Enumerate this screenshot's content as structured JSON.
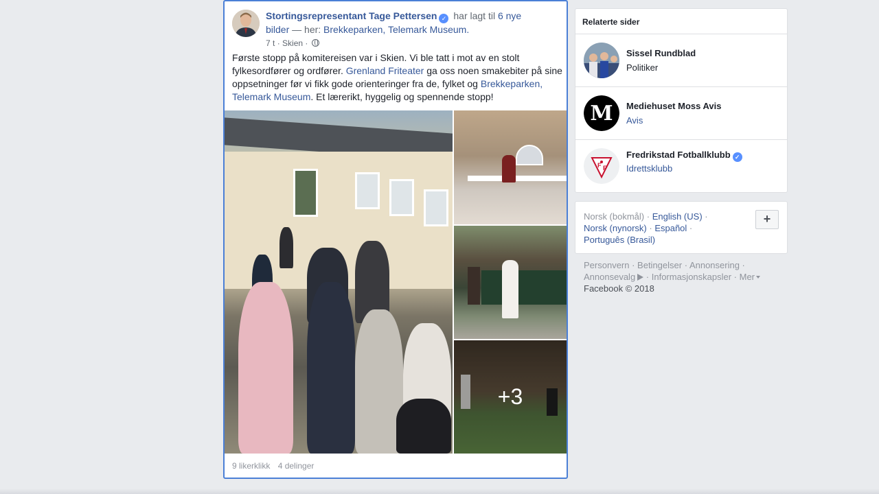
{
  "post": {
    "author": "Stortingsrepresentant Tage Pettersen",
    "action_prefix": "har lagt til",
    "action_link": "6 nye bilder",
    "place_prefix": "— her:",
    "place_link": "Brekkeparken, Telemark Museum.",
    "time": "7 t",
    "location": "Skien",
    "text_1": "Første stopp på komitereisen var i Skien. Vi ble tatt i mot av en stolt fylkesordfører og ordfører.",
    "text_link_1": "Grenland Friteater",
    "text_2": "ga oss noen smakebiter på sine oppsetninger før vi fikk gode orienteringer fra de, fylket og",
    "text_link_2": "Brekkeparken, Telemark Museum",
    "text_3": ". Et lærerikt, hyggelig og spennende stopp!",
    "more_photos": "+3",
    "likes": "9 likerklikk",
    "shares": "4 delinger"
  },
  "related": {
    "title": "Relaterte sider",
    "items": [
      {
        "name": "Sissel Rundblad",
        "sub": "Politiker",
        "verified": false
      },
      {
        "name": "Mediehuset Moss Avis",
        "sub": "Avis",
        "verified": false
      },
      {
        "name": "Fredrikstad Fotballklubb",
        "sub": "Idrettsklubb",
        "verified": true
      }
    ]
  },
  "languages": {
    "current": "Norsk (bokmål)",
    "others": [
      "English (US)",
      "Norsk (nynorsk)",
      "Español",
      "Português (Brasil)"
    ],
    "add_button": "+"
  },
  "footer": {
    "links": [
      "Personvern",
      "Betingelser",
      "Annonsering",
      "Annonsevalg",
      "Informasjonskapsler",
      "Mer"
    ],
    "copyright": "Facebook © 2018"
  },
  "colors": {
    "link": "#365899",
    "verified": "#5890ff",
    "focus_border": "#4a7fd6",
    "background": "#e9ebee"
  }
}
